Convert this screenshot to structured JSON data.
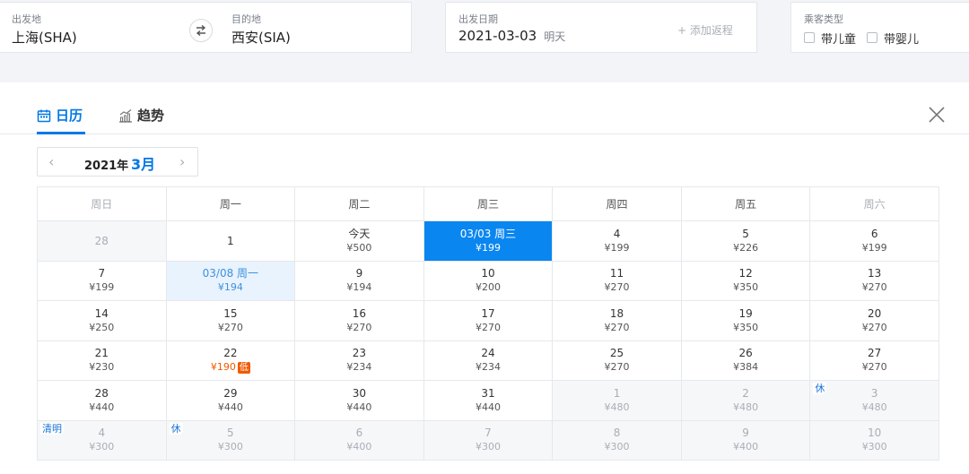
{
  "search": {
    "origin_label": "出发地",
    "origin_value": "上海(SHA)",
    "destination_label": "目的地",
    "destination_value": "西安(SIA)",
    "depart_label": "出发日期",
    "depart_value": "2021-03-03",
    "depart_hint": "明天",
    "add_return": "+ 添加返程",
    "passenger_label": "乘客类型",
    "child_label": "带儿童",
    "infant_label": "带婴儿"
  },
  "tabs": {
    "calendar": "日历",
    "trend": "趋势"
  },
  "month_nav": {
    "year": "2021年",
    "month": "3月",
    "prev": "‹",
    "next": "›"
  },
  "weekdays": [
    "周日",
    "周一",
    "周二",
    "周三",
    "周四",
    "周五",
    "周六"
  ],
  "weeks": [
    [
      {
        "day": "28",
        "price": "",
        "state": "muted",
        "tag": ""
      },
      {
        "day": "1",
        "price": "",
        "state": "",
        "tag": ""
      },
      {
        "day": "今天",
        "price": "¥500",
        "state": "",
        "tag": ""
      },
      {
        "day": "03/03 周三",
        "price": "¥199",
        "state": "sel",
        "tag": ""
      },
      {
        "day": "4",
        "price": "¥199",
        "state": "",
        "tag": ""
      },
      {
        "day": "5",
        "price": "¥226",
        "state": "",
        "tag": ""
      },
      {
        "day": "6",
        "price": "¥199",
        "state": "",
        "tag": ""
      }
    ],
    [
      {
        "day": "7",
        "price": "¥199",
        "state": "",
        "tag": ""
      },
      {
        "day": "03/08 周一",
        "price": "¥194",
        "state": "ret",
        "tag": ""
      },
      {
        "day": "9",
        "price": "¥194",
        "state": "",
        "tag": ""
      },
      {
        "day": "10",
        "price": "¥200",
        "state": "",
        "tag": ""
      },
      {
        "day": "11",
        "price": "¥270",
        "state": "",
        "tag": ""
      },
      {
        "day": "12",
        "price": "¥350",
        "state": "",
        "tag": ""
      },
      {
        "day": "13",
        "price": "¥270",
        "state": "",
        "tag": ""
      }
    ],
    [
      {
        "day": "14",
        "price": "¥250",
        "state": "",
        "tag": ""
      },
      {
        "day": "15",
        "price": "¥270",
        "state": "",
        "tag": ""
      },
      {
        "day": "16",
        "price": "¥270",
        "state": "",
        "tag": ""
      },
      {
        "day": "17",
        "price": "¥270",
        "state": "",
        "tag": ""
      },
      {
        "day": "18",
        "price": "¥270",
        "state": "",
        "tag": ""
      },
      {
        "day": "19",
        "price": "¥350",
        "state": "",
        "tag": ""
      },
      {
        "day": "20",
        "price": "¥270",
        "state": "",
        "tag": ""
      }
    ],
    [
      {
        "day": "21",
        "price": "¥230",
        "state": "",
        "tag": ""
      },
      {
        "day": "22",
        "price": "¥190",
        "state": "low",
        "tag": "",
        "badge": "低"
      },
      {
        "day": "23",
        "price": "¥234",
        "state": "",
        "tag": ""
      },
      {
        "day": "24",
        "price": "¥234",
        "state": "",
        "tag": ""
      },
      {
        "day": "25",
        "price": "¥270",
        "state": "",
        "tag": ""
      },
      {
        "day": "26",
        "price": "¥384",
        "state": "",
        "tag": ""
      },
      {
        "day": "27",
        "price": "¥270",
        "state": "",
        "tag": ""
      }
    ],
    [
      {
        "day": "28",
        "price": "¥440",
        "state": "",
        "tag": ""
      },
      {
        "day": "29",
        "price": "¥440",
        "state": "",
        "tag": ""
      },
      {
        "day": "30",
        "price": "¥440",
        "state": "",
        "tag": ""
      },
      {
        "day": "31",
        "price": "¥440",
        "state": "",
        "tag": ""
      },
      {
        "day": "1",
        "price": "¥480",
        "state": "muted",
        "tag": ""
      },
      {
        "day": "2",
        "price": "¥480",
        "state": "muted",
        "tag": ""
      },
      {
        "day": "3",
        "price": "¥480",
        "state": "muted",
        "tag": "休"
      }
    ],
    [
      {
        "day": "4",
        "price": "¥300",
        "state": "muted",
        "tag": "清明"
      },
      {
        "day": "5",
        "price": "¥300",
        "state": "muted",
        "tag": "休"
      },
      {
        "day": "6",
        "price": "¥400",
        "state": "muted",
        "tag": ""
      },
      {
        "day": "7",
        "price": "¥300",
        "state": "muted",
        "tag": ""
      },
      {
        "day": "8",
        "price": "¥300",
        "state": "muted",
        "tag": ""
      },
      {
        "day": "9",
        "price": "¥400",
        "state": "muted",
        "tag": ""
      },
      {
        "day": "10",
        "price": "¥300",
        "state": "muted",
        "tag": ""
      }
    ]
  ],
  "colors": {
    "accent": "#0078e6",
    "selected": "#0a86f0",
    "low_price": "#f05a00"
  }
}
